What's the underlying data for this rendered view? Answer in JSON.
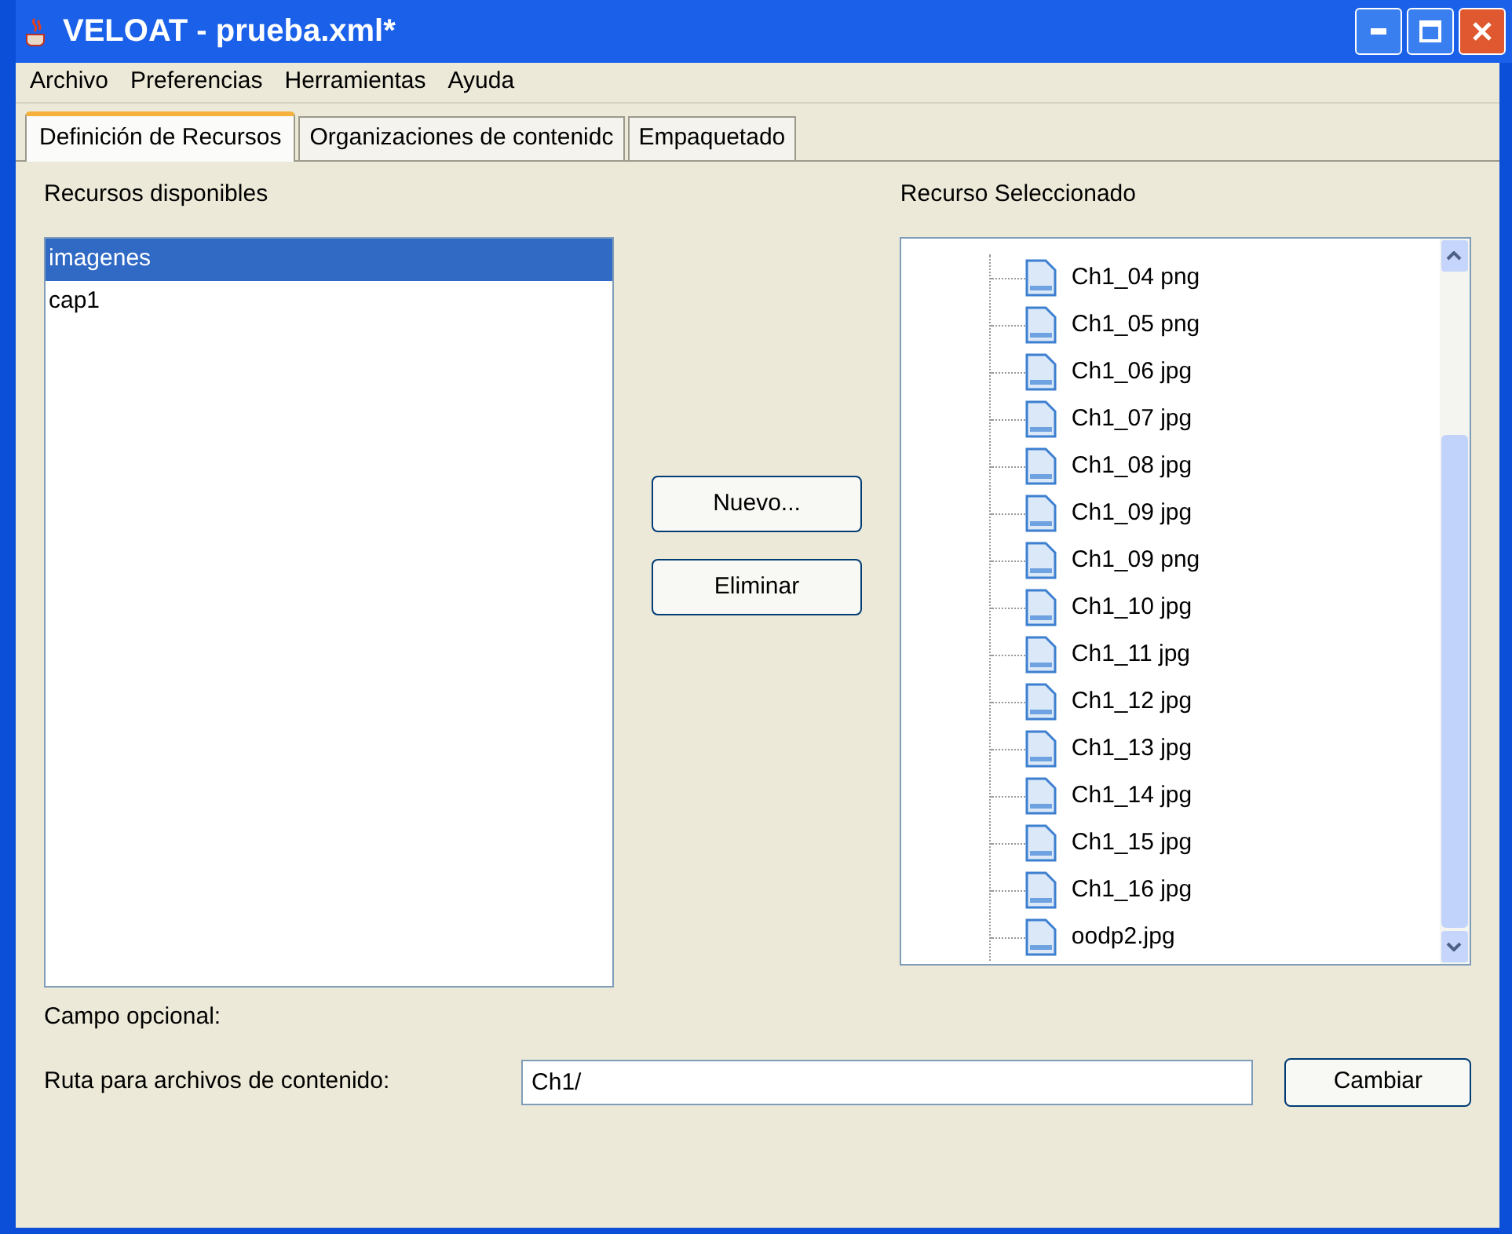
{
  "window": {
    "title": "VELOAT - prueba.xml*"
  },
  "menu": [
    "Archivo",
    "Preferencias",
    "Herramientas",
    "Ayuda"
  ],
  "tabs": [
    {
      "label": "Definición de Recursos",
      "selected": true
    },
    {
      "label": "Organizaciones de contenidc",
      "selected": false
    },
    {
      "label": "Empaquetado",
      "selected": false
    }
  ],
  "available": {
    "label": "Recursos disponibles",
    "items": [
      {
        "label": "imagenes",
        "selected": true
      },
      {
        "label": "cap1",
        "selected": false
      }
    ]
  },
  "buttons": [
    "Nuevo...",
    "Eliminar"
  ],
  "selected_resource": {
    "label": "Recurso Seleccionado",
    "files": [
      "Ch1_04 png",
      "Ch1_05 png",
      "Ch1_06 jpg",
      "Ch1_07 jpg",
      "Ch1_08 jpg",
      "Ch1_09 jpg",
      "Ch1_09 png",
      "Ch1_10 jpg",
      "Ch1_11 jpg",
      "Ch1_12 jpg",
      "Ch1_13 jpg",
      "Ch1_14 jpg",
      "Ch1_15 jpg",
      "Ch1_16 jpg",
      "oodp2.jpg"
    ]
  },
  "optional": {
    "label": "Campo opcional:",
    "path_label": "Ruta para archivos de contenido:",
    "path_value": "Ch1/",
    "button": "Cambiar"
  }
}
